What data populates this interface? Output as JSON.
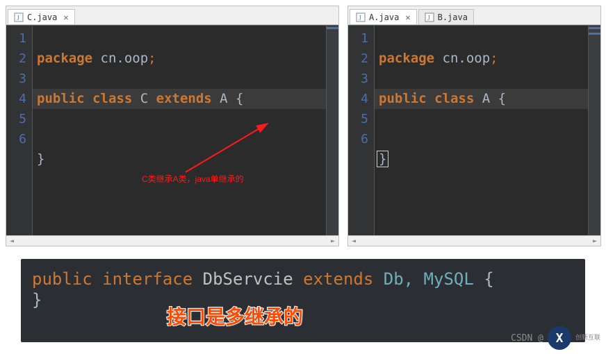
{
  "left_pane": {
    "tabs": [
      {
        "label": "C.java",
        "active": true
      }
    ],
    "lines": [
      "1",
      "2",
      "3",
      "4",
      "5",
      "6"
    ],
    "code": {
      "l1_kw": "package",
      "l1_pkg": " cn.oop",
      "l1_semi": ";",
      "l3_kw1": "public",
      "l3_kw2": "class",
      "l3_cls": " C ",
      "l3_kw3": "extends",
      "l3_super": " A ",
      "l3_brace": "{",
      "l5_brace": "}"
    },
    "annotation": "C类继承A类，java单继承的"
  },
  "right_pane": {
    "tabs": [
      {
        "label": "A.java",
        "active": true
      },
      {
        "label": "B.java",
        "active": false
      }
    ],
    "lines": [
      "1",
      "2",
      "3",
      "4",
      "5",
      "6"
    ],
    "code": {
      "l1_kw": "package",
      "l1_pkg": " cn.oop",
      "l1_semi": ";",
      "l3_kw1": "public",
      "l3_kw2": "class",
      "l3_cls": " A ",
      "l3_brace": "{",
      "l5_brace": "}"
    }
  },
  "bottom": {
    "kw1": "public",
    "kw2": "interface",
    "name": " DbServcie ",
    "kw3": "extends",
    "types": " Db, MySQL ",
    "brace1": "{",
    "brace2": "}",
    "label": "接口是多继承的"
  },
  "watermark": {
    "csdn": "CSDN @",
    "logo_text": "创新互联",
    "logo_letter": "X"
  }
}
